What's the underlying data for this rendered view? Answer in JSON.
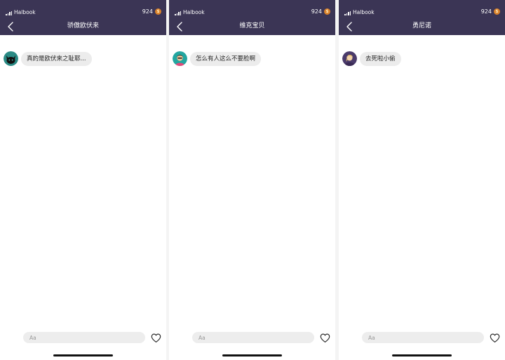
{
  "theme": {
    "header_bg": "#3b3555",
    "bubble_bg": "#ececec",
    "coin_color": "#d9822b",
    "input_bg": "#ededed"
  },
  "screens": [
    {
      "status": {
        "carrier": "Halbook",
        "coins": "924",
        "coin_symbol": "$"
      },
      "nav": {
        "back_icon": "chevron-left-icon",
        "title": "骄傲欧伏来"
      },
      "messages": [
        {
          "avatar_icon": "black-cat-avatar",
          "text": "真的是欧伏来之耻耶..."
        }
      ],
      "composer": {
        "placeholder": "Aa",
        "like_icon": "heart-outline-icon"
      }
    },
    {
      "status": {
        "carrier": "Halbook",
        "coins": "924",
        "coin_symbol": "$"
      },
      "nav": {
        "back_icon": "chevron-left-icon",
        "title": "维克宝贝"
      },
      "messages": [
        {
          "avatar_icon": "girl-teal-avatar",
          "text": "怎么有人这么不要脸啊"
        }
      ],
      "composer": {
        "placeholder": "Aa",
        "like_icon": "heart-outline-icon"
      }
    },
    {
      "status": {
        "carrier": "Halbook",
        "coins": "924",
        "coin_symbol": "$"
      },
      "nav": {
        "back_icon": "chevron-left-icon",
        "title": "勇尼诺"
      },
      "messages": [
        {
          "avatar_icon": "girl-purple-avatar",
          "text": "去死啦小偷"
        }
      ],
      "composer": {
        "placeholder": "Aa",
        "like_icon": "heart-outline-icon"
      }
    }
  ]
}
